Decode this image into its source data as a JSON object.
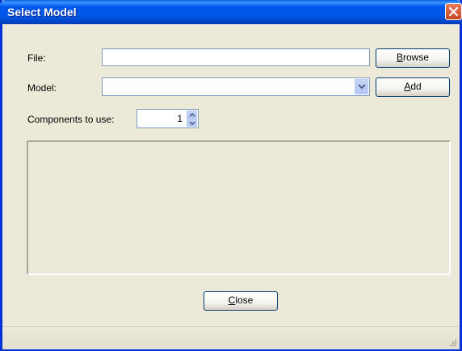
{
  "window": {
    "title": "Select Model"
  },
  "form": {
    "file_label": "File:",
    "file_value": "",
    "browse_button": {
      "prefix": "",
      "mnemonic": "B",
      "rest": "rowse"
    },
    "model_label": "Model:",
    "model_value": "",
    "add_button": {
      "prefix": "",
      "mnemonic": "A",
      "rest": "dd"
    },
    "components_label": "Components to use:",
    "components_value": "1"
  },
  "footer": {
    "close_button": {
      "prefix": "",
      "mnemonic": "C",
      "rest": "lose"
    }
  },
  "icons": {
    "close": "close-icon",
    "combo": "chevron-down-icon",
    "spin_up": "chevron-up-icon",
    "spin_down": "chevron-down-icon",
    "grip": "resize-grip-icon"
  },
  "colors": {
    "titlebar": "#0055e5",
    "window_bg": "#ece9d8",
    "close_button": "#c94422"
  }
}
